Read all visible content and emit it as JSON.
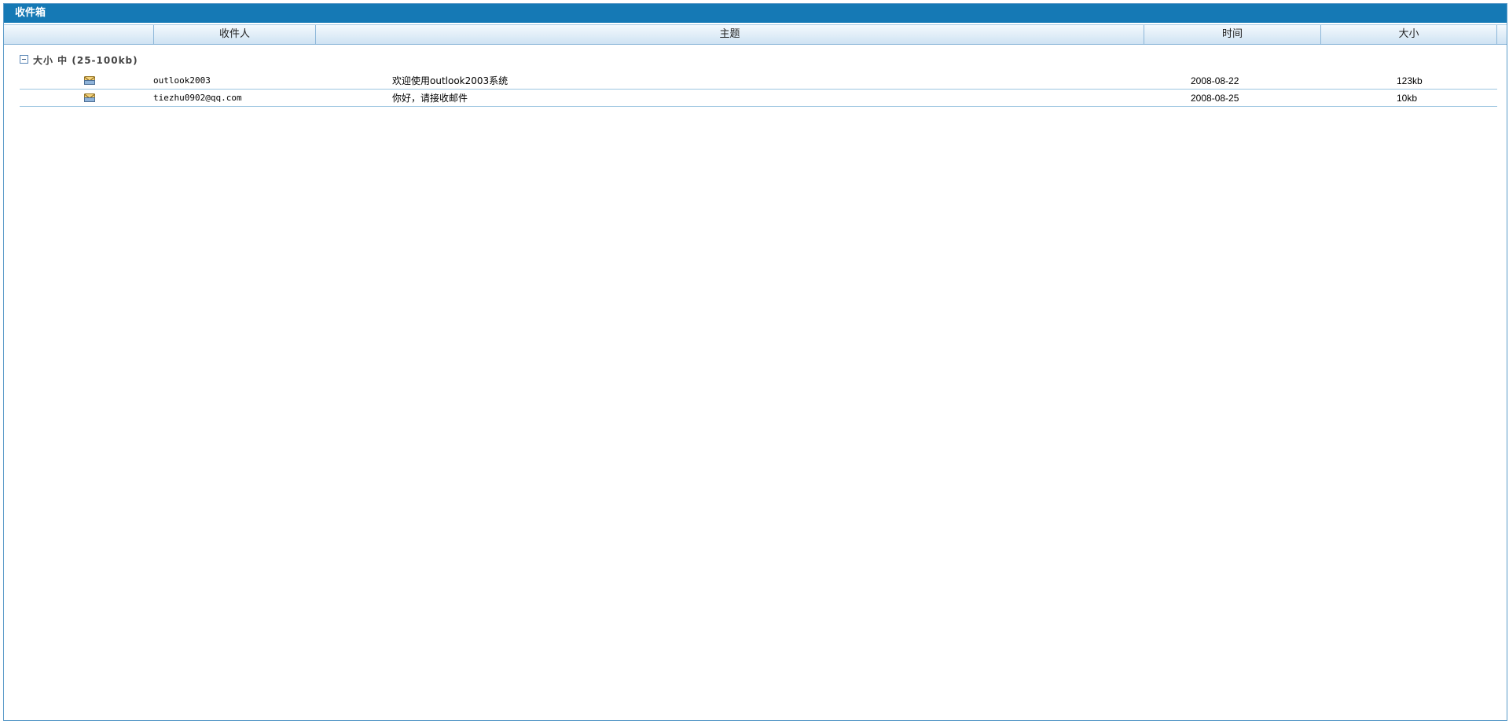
{
  "window": {
    "title": "收件箱"
  },
  "columns": {
    "recipient": "收件人",
    "subject": "主题",
    "time": "时间",
    "size": "大小"
  },
  "group": {
    "label": "大小 中 (25-100kb)"
  },
  "rows": [
    {
      "recipient": "outlook2003",
      "subject": "欢迎使用outlook2003系统",
      "time": "2008-08-22",
      "size": "123kb",
      "icon": "envelope-icon"
    },
    {
      "recipient": "tiezhu0902@qq.com",
      "subject": "你好，请接收邮件",
      "time": "2008-08-25",
      "size": "10kb",
      "icon": "envelope-icon"
    }
  ],
  "colors": {
    "titlebar": "#1579b5",
    "header_gradient_top": "#f4f9fd",
    "header_gradient_bottom": "#cfe3f3",
    "border": "#5a9ac8",
    "row_separator": "#9cc5e0"
  }
}
